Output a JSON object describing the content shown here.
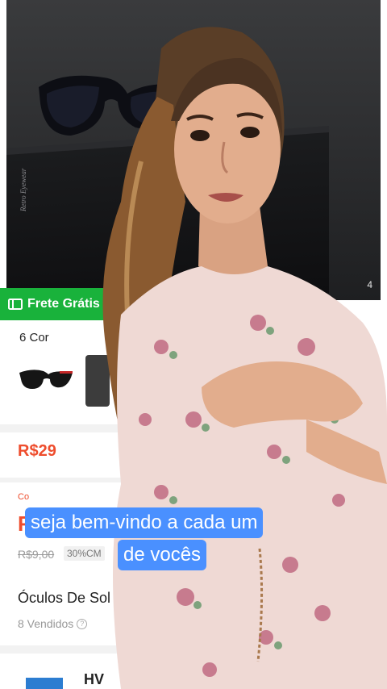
{
  "hero": {
    "brand_watermark": "Retro Eyewear",
    "image_counter": "4"
  },
  "badge": {
    "icon": "ticket-icon",
    "label": "Frete Grátis"
  },
  "variants": {
    "label": "6 Cor"
  },
  "pricing": {
    "price_range": "R$29",
    "coupon_label": "Co",
    "big_price": "R",
    "original_price": "R$9,00",
    "discount_tag": "30%CM"
  },
  "product": {
    "title": "Óculos De Sol  A",
    "sold": "8 Vendidos"
  },
  "store": {
    "name": "HV"
  },
  "captions": {
    "line1": "seja bem-vindo a cada um",
    "line2": "de vocês"
  },
  "colors": {
    "accent": "#ee4d2d",
    "free_shipping": "#19b23b",
    "caption_bg": "#4a90ff"
  }
}
